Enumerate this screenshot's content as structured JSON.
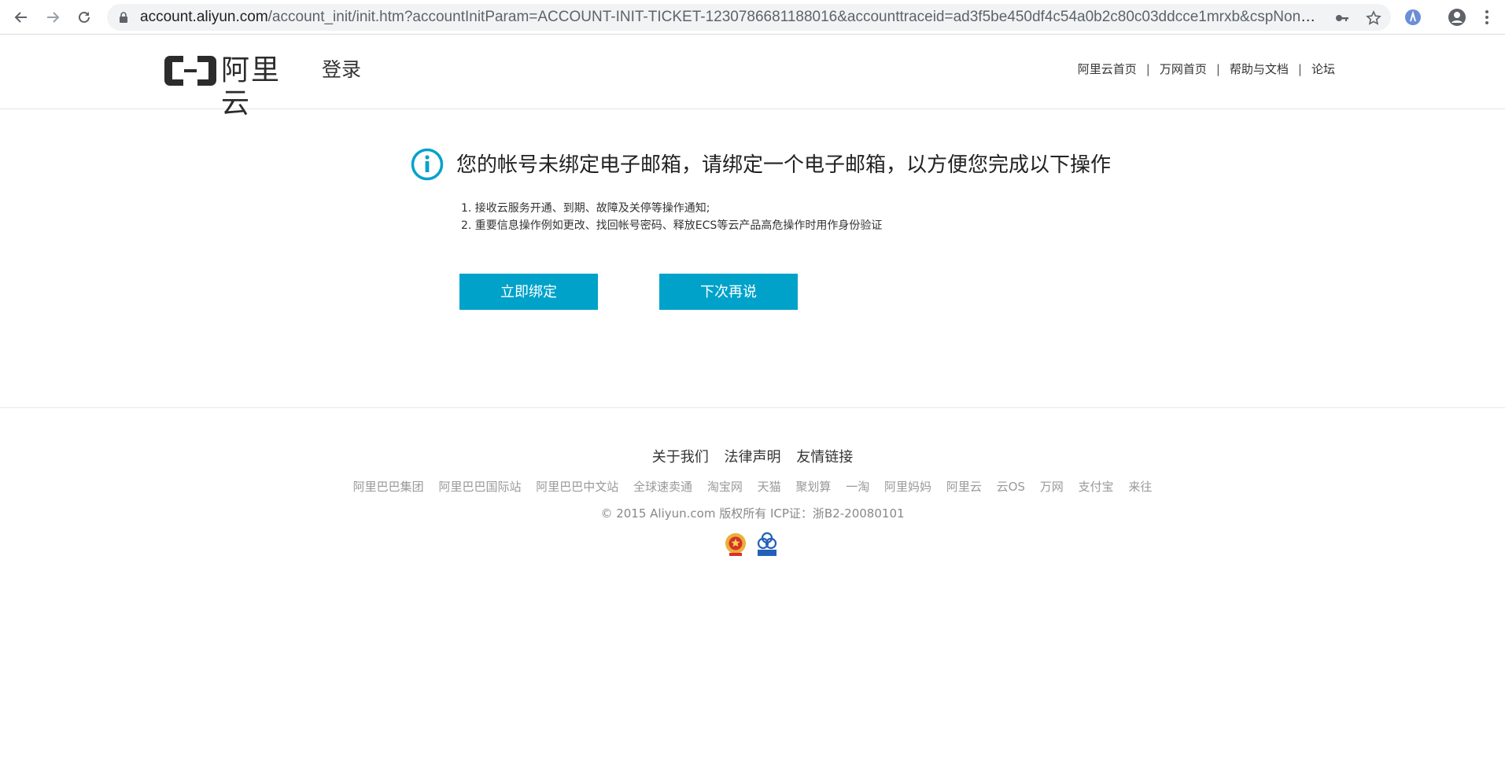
{
  "browser": {
    "url_host": "account.aliyun.com",
    "url_rest": "/account_init/init.htm?accountInitParam=ACCOUNT-INIT-TICKET-1230786681188016&accounttraceid=ad3f5be450df4c54a0b2c80c03ddcce1mrxb&cspNonce..."
  },
  "header": {
    "logo_text": "阿里云",
    "page_title": "登录",
    "links": [
      "阿里云首页",
      "万网首页",
      "帮助与文档",
      "论坛"
    ]
  },
  "notice": {
    "title": "您的帐号未绑定电子邮箱，请绑定一个电子邮箱，以方便您完成以下操作",
    "items": [
      "1. 接收云服务开通、到期、故障及关停等操作通知;",
      "2. 重要信息操作例如更改、找回帐号密码、释放ECS等云产品高危操作时用作身份验证"
    ],
    "bind_button": "立即绑定",
    "later_button": "下次再说"
  },
  "footer": {
    "main_links": [
      "关于我们",
      "法律声明",
      "友情链接"
    ],
    "sub_links": [
      "阿里巴巴集团",
      "阿里巴巴国际站",
      "阿里巴巴中文站",
      "全球速卖通",
      "淘宝网",
      "天猫",
      "聚划算",
      "一淘",
      "阿里妈妈",
      "阿里云",
      "云OS",
      "万网",
      "支付宝",
      "来往"
    ],
    "copyright": "© 2015 Aliyun.com 版权所有 ICP证：浙B2-20080101"
  },
  "colors": {
    "accent": "#00a2ca",
    "logo": "#2c2c2c"
  }
}
